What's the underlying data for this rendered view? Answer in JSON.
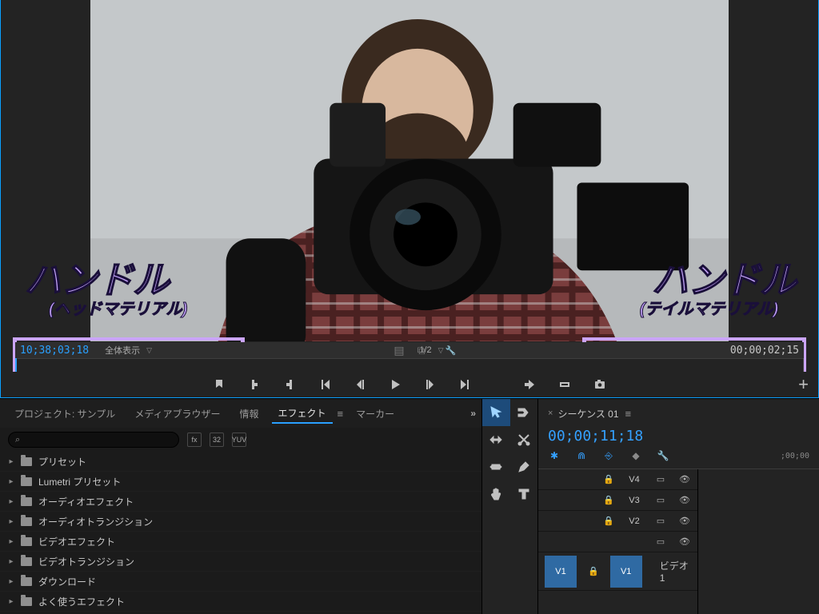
{
  "annotations": {
    "left_big": "ハンドル",
    "left_small": "(ヘッドマテリアル)",
    "right_big": "ハンドル",
    "right_small": "(テイルマテリアル)"
  },
  "source_monitor": {
    "in_timecode": "10;38;03;18",
    "mode_label": "全体表示",
    "zoom_label": "1/2",
    "out_timecode": "00;00;02;15"
  },
  "transport": {
    "add_marker": "マーカー追加",
    "in_point": "インポイント",
    "out_point": "アウトポイント",
    "goto_in": "インへ移動",
    "step_back": "1フレーム戻る",
    "play": "再生",
    "step_fwd": "1フレーム進む",
    "goto_out": "アウトへ移動",
    "insert": "インサート",
    "overwrite": "上書き",
    "export_frame": "フレーム書き出し"
  },
  "panels": {
    "tabs": {
      "project": "プロジェクト: サンプル",
      "media_browser": "メディアブラウザー",
      "info": "情報",
      "effects": "エフェクト",
      "markers": "マーカー"
    },
    "search_placeholder": "",
    "search_buttons": {
      "a": "fx",
      "b": "32",
      "c": "YUV"
    },
    "effect_tree": [
      "プリセット",
      "Lumetri プリセット",
      "オーディオエフェクト",
      "オーディオトランジション",
      "ビデオエフェクト",
      "ビデオトランジション",
      "ダウンロード",
      "よく使うエフェクト"
    ]
  },
  "tools": {
    "selection": "選択",
    "track_select": "トラック選択",
    "ripple": "リップル",
    "razor": "レーザー",
    "slip": "スリップ",
    "pen": "ペン",
    "hand": "手のひら",
    "type": "文字"
  },
  "timeline": {
    "sequence_name": "シーケンス 01",
    "timecode": "00;00;11;18",
    "start_label": ";00;00",
    "tracks": [
      {
        "name": "V4"
      },
      {
        "name": "V3"
      },
      {
        "name": "V2"
      }
    ],
    "selected_track": {
      "src": "V1",
      "rec": "V1",
      "label": "ビデオ 1"
    }
  }
}
